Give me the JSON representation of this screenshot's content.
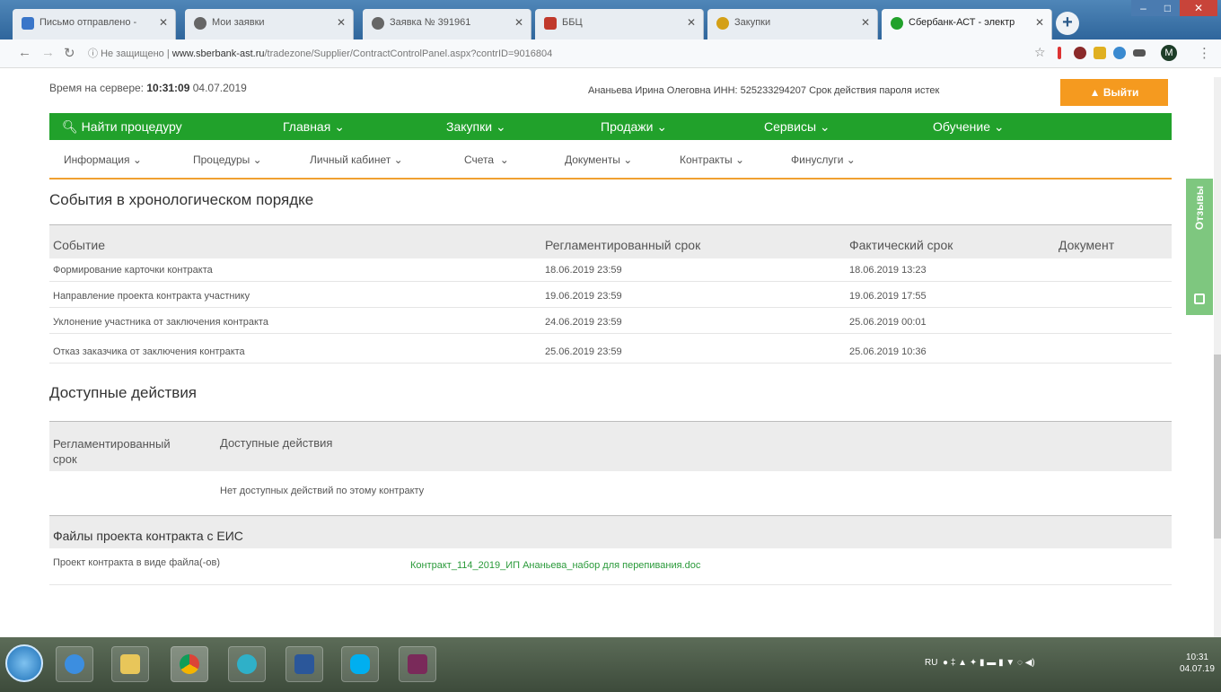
{
  "browser": {
    "tabs": [
      {
        "label": "Письмо отправлено - ",
        "color": "#3a76c9"
      },
      {
        "label": "Мои заявки",
        "color": "#666666"
      },
      {
        "label": "Заявка № 391961",
        "color": "#666666"
      },
      {
        "label": "ББЦ",
        "color": "#c0392b"
      },
      {
        "label": "Закупки",
        "color": "#d4a017"
      },
      {
        "label": "Сбербанк-АСТ - электр",
        "color": "#21a12b"
      }
    ],
    "new_tab": "+",
    "security_label": "Не защищено",
    "url_host": "www.sberbank-ast.ru",
    "url_path": "/tradezone/Supplier/ContractControlPanel.aspx?contrID=9016804",
    "profile_initial": "M"
  },
  "header": {
    "server_time_label": "Время на сервере:",
    "server_time": "10:31:09",
    "server_date": "04.07.2019",
    "user_info": "Ананьева Ирина Олеговна ИНН: 525233294207 Срок действия пароля истек",
    "logout_label": "Выйти"
  },
  "green_nav": {
    "search": "Найти процедуру",
    "items": [
      "Главная",
      "Закупки",
      "Продажи",
      "Сервисы",
      "Обучение"
    ]
  },
  "sub_nav": [
    "Информация",
    "Процедуры",
    "Личный кабинет",
    "Счета",
    "Документы",
    "Контракты",
    "Финуслуги"
  ],
  "events": {
    "title": "События в хронологическом порядке",
    "columns": [
      "Событие",
      "Регламентированный срок",
      "Фактический срок",
      "Документ"
    ],
    "rows": [
      {
        "event": "Формирование карточки контракта",
        "reg": "18.06.2019 23:59",
        "fact": "18.06.2019 13:23",
        "doc": ""
      },
      {
        "event": "Направление проекта контракта участнику",
        "reg": "19.06.2019 23:59",
        "fact": "19.06.2019 17:55",
        "doc": ""
      },
      {
        "event": "Уклонение участника от заключения контракта",
        "reg": "24.06.2019 23:59",
        "fact": "25.06.2019 00:01",
        "doc": ""
      },
      {
        "event": "Отказ заказчика от заключения контракта",
        "reg": "25.06.2019 23:59",
        "fact": "25.06.2019 10:36",
        "doc": ""
      }
    ]
  },
  "actions": {
    "title": "Доступные действия",
    "col_deadline": "Регламентированный срок",
    "col_actions": "Доступные действия",
    "empty_text": "Нет доступных действий по этому контракту"
  },
  "files": {
    "title": "Файлы проекта контракта с ЕИС",
    "row_label": "Проект контракта в виде файла(-ов)",
    "file_link": "Контракт_114_2019_ИП Ананьева_набор для перепивания.doc"
  },
  "feedback_label": "Отзывы",
  "taskbar": {
    "lang": "RU",
    "time": "10:31",
    "date": "04.07.19"
  },
  "colors": {
    "green": "#21a12b",
    "orange": "#f59a1f",
    "link": "#2a9a3a"
  }
}
